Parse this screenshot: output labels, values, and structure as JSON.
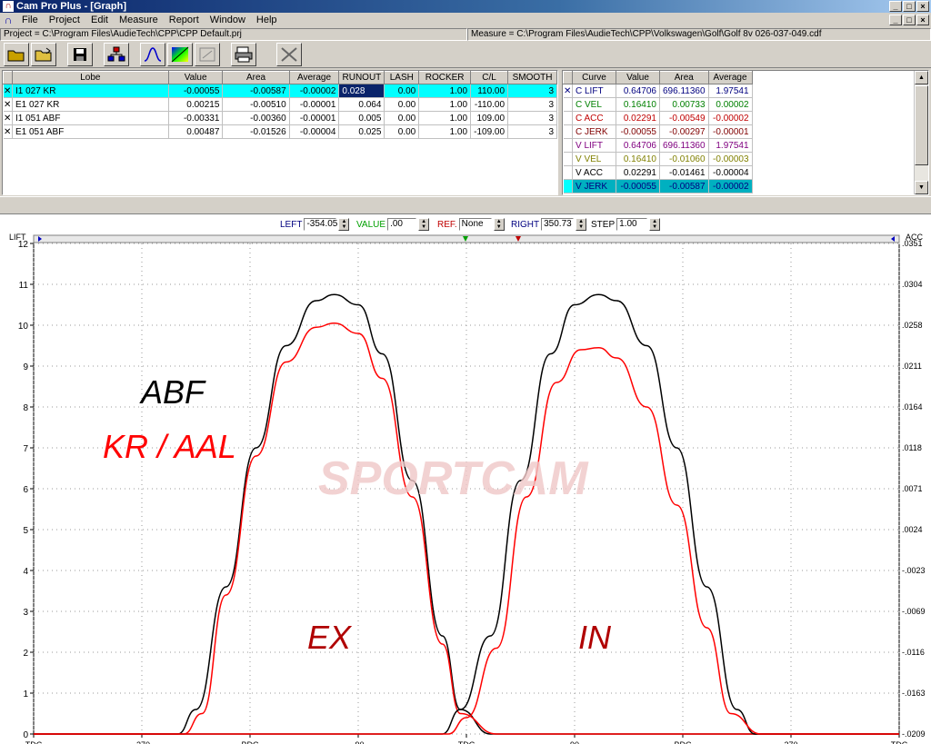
{
  "window": {
    "title": "Cam Pro Plus - [Graph]"
  },
  "menu": [
    "File",
    "Project",
    "Edit",
    "Measure",
    "Report",
    "Window",
    "Help"
  ],
  "paths": {
    "project": "Project = C:\\Program Files\\AudieTech\\CPP\\CPP Default.prj",
    "measure": "Measure = C:\\Program Files\\AudieTech\\CPP\\Volkswagen\\Golf\\Golf 8v 026-037-049.cdf"
  },
  "toolbar": [
    "open-folder-icon",
    "open-file-icon",
    "save-icon",
    "network-icon",
    "curve-icon",
    "color-spectrum-icon",
    "export-icon",
    "print-icon",
    "close-x-icon"
  ],
  "lobe_table": {
    "columns": [
      "Lobe",
      "Value",
      "Area",
      "Average",
      "RUNOUT",
      "LASH",
      "ROCKER",
      "C/L",
      "SMOOTH"
    ],
    "rows": [
      {
        "lobe": "I1 027 KR",
        "value": "-0.00055",
        "area": "-0.00587",
        "average": "-0.00002",
        "runout": "0.028",
        "lash": "0.00",
        "rocker": "1.00",
        "cl": "110.00",
        "smooth": "3",
        "selected": true
      },
      {
        "lobe": "E1 027 KR",
        "value": "0.00215",
        "area": "-0.00510",
        "average": "-0.00001",
        "runout": "0.064",
        "lash": "0.00",
        "rocker": "1.00",
        "cl": "-110.00",
        "smooth": "3"
      },
      {
        "lobe": "I1 051 ABF",
        "value": "-0.00331",
        "area": "-0.00360",
        "average": "-0.00001",
        "runout": "0.005",
        "lash": "0.00",
        "rocker": "1.00",
        "cl": "109.00",
        "smooth": "3"
      },
      {
        "lobe": "E1 051 ABF",
        "value": "0.00487",
        "area": "-0.01526",
        "average": "-0.00004",
        "runout": "0.025",
        "lash": "0.00",
        "rocker": "1.00",
        "cl": "-109.00",
        "smooth": "3"
      }
    ]
  },
  "curve_table": {
    "columns": [
      "Curve",
      "Value",
      "Area",
      "Average"
    ],
    "rows": [
      {
        "curve": "C LIFT",
        "value": "0.64706",
        "area": "696.11360",
        "average": "1.97541",
        "color": "#00007f",
        "checked": true
      },
      {
        "curve": "C VEL",
        "value": "0.16410",
        "area": "0.00733",
        "average": "0.00002",
        "color": "#008000"
      },
      {
        "curve": "C ACC",
        "value": "0.02291",
        "area": "-0.00549",
        "average": "-0.00002",
        "color": "#c00000"
      },
      {
        "curve": "C JERK",
        "value": "-0.00055",
        "area": "-0.00297",
        "average": "-0.00001",
        "color": "#800000"
      },
      {
        "curve": "V LIFT",
        "value": "0.64706",
        "area": "696.11360",
        "average": "1.97541",
        "color": "#800080"
      },
      {
        "curve": "V VEL",
        "value": "0.16410",
        "area": "-0.01060",
        "average": "-0.00003",
        "color": "#808000"
      },
      {
        "curve": "V ACC",
        "value": "0.02291",
        "area": "-0.01461",
        "average": "-0.00004",
        "color": "#000000"
      },
      {
        "curve": "V JERK",
        "value": "-0.00055",
        "area": "-0.00587",
        "average": "-0.00002",
        "color": "#000080",
        "selected": true
      }
    ]
  },
  "controls": {
    "left_label": "LEFT",
    "left_value": "-354.05",
    "value_label": "VALUE",
    "value_value": ".00",
    "ref_label": "REF.",
    "ref_value": "None",
    "right_label": "RIGHT",
    "right_value": "350.73",
    "step_label": "STEP",
    "step_value": "1.00"
  },
  "chart_data": {
    "type": "line",
    "ylabel_left": "LIFT",
    "ylabel_right": "ACC",
    "ylim": [
      0,
      12
    ],
    "yticks": [
      0,
      1,
      2,
      3,
      4,
      5,
      6,
      7,
      8,
      9,
      10,
      11,
      12
    ],
    "right_ticks": [
      "-.0209",
      "-.0163",
      "-.0116",
      "-.0069",
      "-.0023",
      ".0024",
      ".0071",
      ".0118",
      ".0164",
      ".0211",
      ".0258",
      ".0304",
      ".0351"
    ],
    "xlim": [
      -360,
      360
    ],
    "xticks": [
      -360,
      -270,
      -180,
      -90,
      0,
      90,
      180,
      270,
      360
    ],
    "xtick_labels": [
      "TDC",
      "-270",
      "BDC",
      "-90",
      "TDC",
      "90",
      "BDC",
      "270",
      "TDC"
    ],
    "series": [
      {
        "color": "#000000",
        "x": [
          -240,
          -225,
          -200,
          -175,
          -150,
          -125,
          -110,
          -90,
          -70,
          -45,
          -20,
          -5,
          20
        ],
        "y": [
          0,
          0.6,
          3.6,
          7.0,
          9.5,
          10.6,
          10.75,
          10.5,
          9.3,
          6.2,
          2.4,
          0.6,
          0
        ]
      },
      {
        "color": "#ff0000",
        "x": [
          -235,
          -220,
          -200,
          -175,
          -150,
          -125,
          -110,
          -90,
          -70,
          -45,
          -20,
          -5,
          25
        ],
        "y": [
          0,
          0.5,
          3.4,
          6.8,
          9.1,
          9.95,
          10.05,
          9.8,
          8.7,
          5.8,
          2.2,
          0.5,
          0
        ]
      },
      {
        "color": "#000000",
        "x": [
          -20,
          -5,
          20,
          45,
          70,
          90,
          110,
          125,
          150,
          175,
          200,
          225,
          240
        ],
        "y": [
          0,
          0.6,
          2.4,
          6.2,
          9.3,
          10.5,
          10.75,
          10.6,
          9.5,
          7.0,
          3.6,
          0.6,
          0
        ]
      },
      {
        "color": "#ff0000",
        "x": [
          -15,
          0,
          25,
          50,
          75,
          95,
          110,
          125,
          150,
          175,
          200,
          220,
          245
        ],
        "y": [
          0,
          0.4,
          2.1,
          5.8,
          8.6,
          9.4,
          9.45,
          9.2,
          8.0,
          5.6,
          2.6,
          0.5,
          0
        ]
      }
    ],
    "annotations": [
      {
        "text": "ABF",
        "color": "#000000"
      },
      {
        "text": "KR / AAL",
        "color": "#ff0000"
      },
      {
        "text": "EX",
        "color": "#b00000"
      },
      {
        "text": "IN",
        "color": "#b00000"
      },
      {
        "text": "SPORTCAM",
        "color": "#f0c8c8"
      }
    ]
  }
}
